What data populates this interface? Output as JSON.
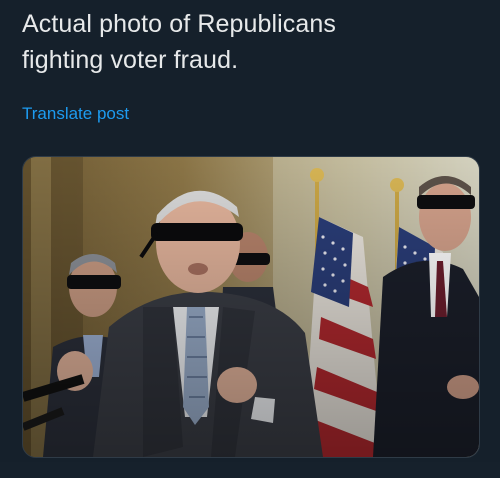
{
  "post": {
    "text_lines": [
      "Actual photo of Republicans",
      "fighting voter fraud."
    ],
    "translate_label": "Translate post"
  },
  "colors": {
    "background": "#15202b",
    "text": "#e7e9ea",
    "link": "#1d9bf0"
  },
  "media": {
    "icon": "photo-image"
  }
}
